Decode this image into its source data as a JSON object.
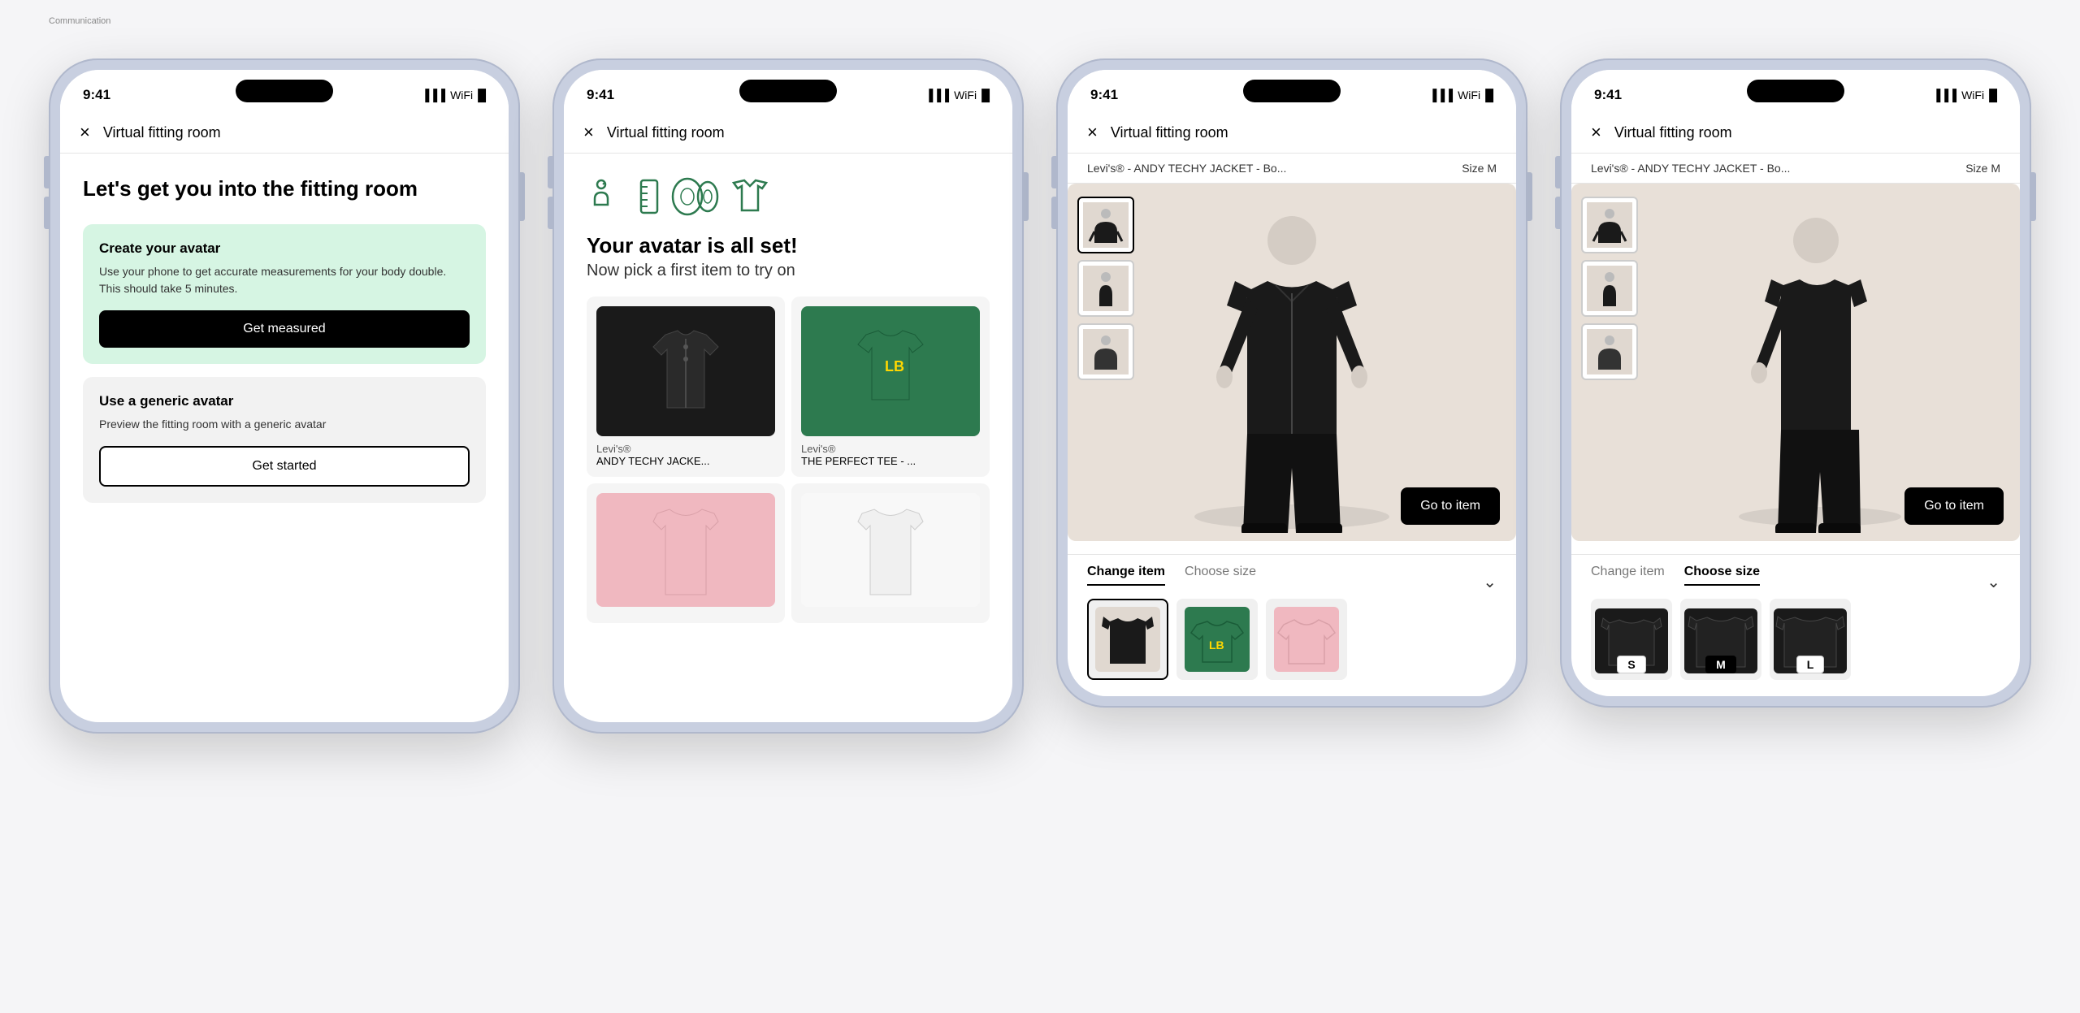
{
  "page": {
    "label": "Communication"
  },
  "phones": [
    {
      "id": "phone1",
      "time": "9:41",
      "nav_close": "×",
      "nav_title": "Virtual fitting room",
      "screen": "onboarding",
      "title": "Let's get you into the fitting room",
      "card1": {
        "title": "Create your avatar",
        "desc": "Use your phone to get accurate measurements for your body double. This should take 5 minutes.",
        "btn": "Get measured",
        "bg": "green"
      },
      "card2": {
        "title": "Use a generic avatar",
        "desc": "Preview the fitting room with a generic avatar",
        "btn": "Get started",
        "bg": "gray"
      }
    },
    {
      "id": "phone2",
      "time": "9:41",
      "nav_close": "×",
      "nav_title": "Virtual fitting room",
      "screen": "avatar_set",
      "title": "Your avatar is all set!",
      "subtitle": "Now pick a first item to try on",
      "items": [
        {
          "brand": "Levi's®",
          "name": "ANDY TECHY JACKE...",
          "color": "black",
          "type": "jacket"
        },
        {
          "brand": "Levi's®",
          "name": "THE PERFECT TEE - ...",
          "color": "green",
          "type": "tee"
        },
        {
          "brand": "",
          "name": "",
          "color": "pink",
          "type": "top"
        },
        {
          "brand": "",
          "name": "",
          "color": "white",
          "type": "top"
        }
      ]
    },
    {
      "id": "phone3",
      "time": "9:41",
      "nav_close": "×",
      "nav_title": "Virtual fitting room",
      "product_name": "Levi's® - ANDY TECHY JACKET - Bo...",
      "size": "Size M",
      "screen": "fitting_change_item",
      "go_to_item": "Go to item",
      "tab_change": "Change item",
      "tab_choose": "Choose size",
      "active_tab": "change_item",
      "scroll_items": [
        {
          "type": "jacket",
          "color": "black",
          "selected": true
        },
        {
          "type": "tee",
          "color": "green",
          "selected": false
        },
        {
          "type": "top",
          "color": "pink",
          "selected": false
        }
      ]
    },
    {
      "id": "phone4",
      "time": "9:41",
      "nav_close": "×",
      "nav_title": "Virtual fitting room",
      "product_name": "Levi's® - ANDY TECHY JACKET - Bo...",
      "size": "Size M",
      "screen": "fitting_choose_size",
      "go_to_item": "Go to item",
      "tab_change": "Change item",
      "tab_choose": "Choose size",
      "active_tab": "choose_size",
      "sizes": [
        {
          "label": "S",
          "selected": false
        },
        {
          "label": "M",
          "selected": true
        },
        {
          "label": "L",
          "selected": false
        }
      ]
    }
  ]
}
